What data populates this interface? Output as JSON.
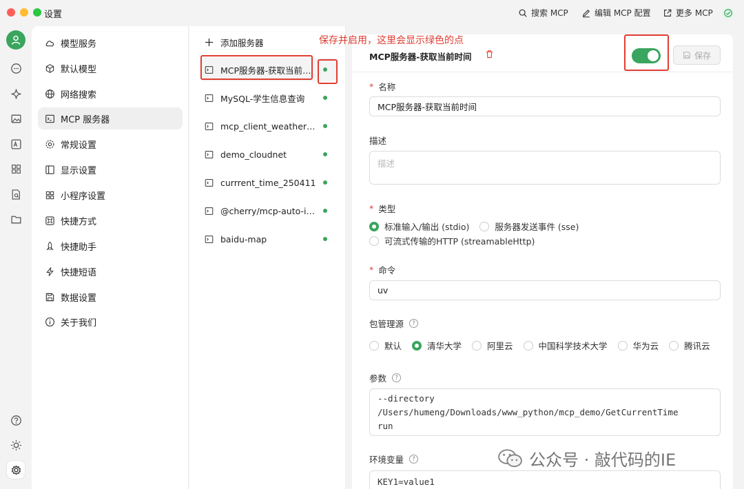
{
  "window": {
    "title": "设置"
  },
  "toolbar": {
    "search_mcp": "搜索 MCP",
    "edit_mcp": "编辑 MCP 配置",
    "more_mcp": "更多 MCP"
  },
  "menu": {
    "items": [
      {
        "label": "模型服务",
        "icon": "cloud-icon"
      },
      {
        "label": "默认模型",
        "icon": "cube-icon"
      },
      {
        "label": "网络搜索",
        "icon": "globe-icon"
      },
      {
        "label": "MCP 服务器",
        "icon": "terminal-icon"
      },
      {
        "label": "常规设置",
        "icon": "gear-icon"
      },
      {
        "label": "显示设置",
        "icon": "display-icon"
      },
      {
        "label": "小程序设置",
        "icon": "grid-icon"
      },
      {
        "label": "快捷方式",
        "icon": "command-icon"
      },
      {
        "label": "快捷助手",
        "icon": "rocket-icon"
      },
      {
        "label": "快捷短语",
        "icon": "lightning-icon"
      },
      {
        "label": "数据设置",
        "icon": "save-icon"
      },
      {
        "label": "关于我们",
        "icon": "info-icon"
      }
    ]
  },
  "servers": {
    "add_label": "添加服务器",
    "items": [
      {
        "name": "MCP服务器-获取当前时间"
      },
      {
        "name": "MySQL-学生信息查询"
      },
      {
        "name": "mcp_client_weather_se..."
      },
      {
        "name": "demo_cloudnet"
      },
      {
        "name": "currrent_time_250411"
      },
      {
        "name": "@cherry/mcp-auto-install"
      },
      {
        "name": "baidu-map"
      }
    ]
  },
  "annotation": {
    "text": "保存并启用，这里会显示绿色的点"
  },
  "detail": {
    "title": "MCP服务器-获取当前时间",
    "save_label": "保存",
    "enabled": true,
    "name_label": "名称",
    "name_value": "MCP服务器-获取当前时间",
    "desc_label": "描述",
    "desc_placeholder": "描述",
    "type_label": "类型",
    "type_options": [
      "标准输入/输出 (stdio)",
      "服务器发送事件 (sse)",
      "可流式传输的HTTP (streamableHttp)"
    ],
    "type_selected": 0,
    "command_label": "命令",
    "command_value": "uv",
    "registry_label": "包管理源",
    "registry_options": [
      "默认",
      "清华大学",
      "阿里云",
      "中国科学技术大学",
      "华为云",
      "腾讯云"
    ],
    "registry_selected": 1,
    "args_label": "参数",
    "args_value": "--directory\n/Users/humeng/Downloads/www_python/mcp_demo/GetCurrentTime\nrun",
    "env_label": "环境变量",
    "env_placeholder": "KEY1=value1"
  },
  "watermark": {
    "text": "公众号 · 敲代码的IE"
  },
  "colors": {
    "accent": "#3aa55e",
    "danger": "#e03c31",
    "light_red": "#fe5f57",
    "light_yellow": "#febc2e",
    "light_green": "#28c840"
  }
}
